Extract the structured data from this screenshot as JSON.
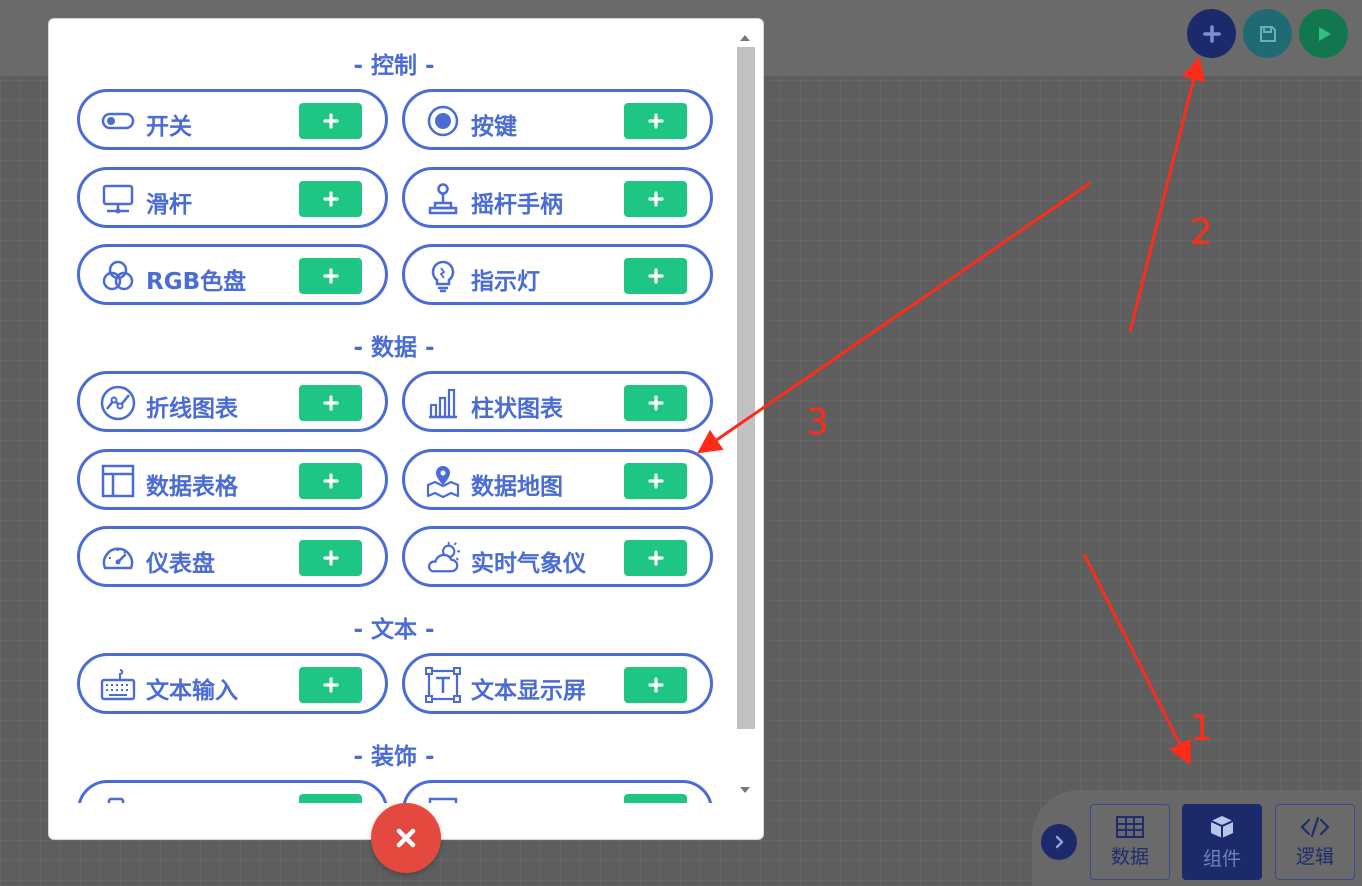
{
  "sections": [
    {
      "title": "- 控制 -",
      "items": [
        {
          "label": "开关"
        },
        {
          "label": "按键"
        },
        {
          "label": "滑杆"
        },
        {
          "label": "摇杆手柄"
        },
        {
          "label": "RGB色盘"
        },
        {
          "label": "指示灯"
        }
      ]
    },
    {
      "title": "- 数据 -",
      "items": [
        {
          "label": "折线图表"
        },
        {
          "label": "柱状图表"
        },
        {
          "label": "数据表格"
        },
        {
          "label": "数据地图"
        },
        {
          "label": "仪表盘"
        },
        {
          "label": "实时气象仪"
        }
      ]
    },
    {
      "title": "- 文本 -",
      "items": [
        {
          "label": "文本输入"
        },
        {
          "label": "文本显示屏"
        }
      ]
    },
    {
      "title": "- 装饰 -",
      "items": [
        {
          "label": ""
        },
        {
          "label": ""
        }
      ]
    }
  ],
  "bottom_tabs": [
    {
      "label": "数据"
    },
    {
      "label": "组件"
    },
    {
      "label": "逻辑"
    }
  ],
  "annotations": [
    {
      "label": "1"
    },
    {
      "label": "2"
    },
    {
      "label": "3"
    }
  ],
  "colors": {
    "accent": "#4a6cd4",
    "add_green": "#1fc583",
    "close_red": "#e3493f",
    "navy": "#1c2a6b",
    "annotation_red": "#ff2b1a"
  }
}
